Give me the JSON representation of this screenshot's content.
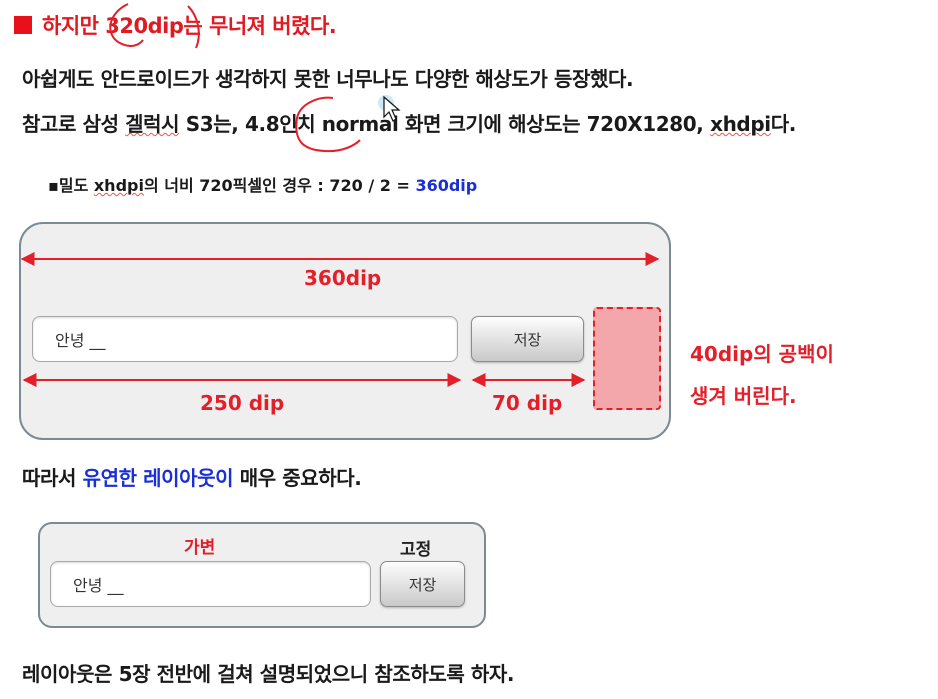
{
  "title": "하지만 320dip는 무너져 버렸다.",
  "line1": "아쉽게도 안드로이드가 생각하지 못한 너무나도 다양한 해상도가 등장했다.",
  "line2": {
    "prefix": "참고로 삼성 ",
    "galaxy": "겔럭시",
    "middle": " S3는, 4.8인치 normal 화면 크기에 해상도는 720X1280, ",
    "xhdpi": "xhdpi",
    "suffix": "다."
  },
  "bullet": {
    "prefix": "▪밀도 ",
    "xhdpi": "xhdpi",
    "middle": "의 너비 720픽셀인 경우 : 720 / 2 = ",
    "result": "360dip"
  },
  "figure1": {
    "width_label": "360dip",
    "input_text": "안녕  __",
    "button_label": "저장",
    "input_width_label": "250 dip",
    "button_width_label": "70 dip",
    "note_line1": "40dip의 공백이",
    "note_line2": "생겨 버린다."
  },
  "line3": {
    "prefix": "따라서 ",
    "highlight": "유연한 레이아웃이",
    "suffix": " 매우 중요하다."
  },
  "figure2": {
    "variable_label": "가변",
    "fixed_label": "고정",
    "input_text": "안녕 __",
    "button_label": "저장"
  },
  "line4": "레이아웃은 5장 전반에 걸쳐 설명되었으니 참조하도록 하자.",
  "colors": {
    "red": "#e3202a",
    "blue": "#1a2fd6",
    "panel_border": "#7b8a93"
  }
}
